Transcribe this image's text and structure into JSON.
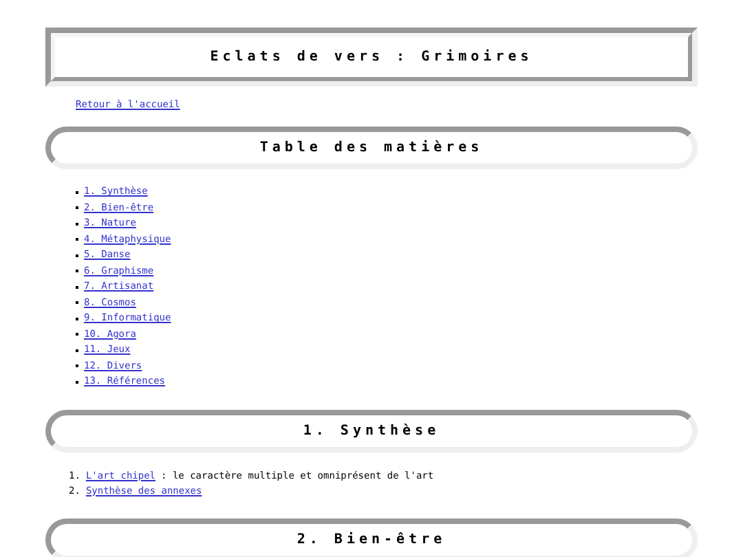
{
  "site_title": "Eclats de vers : Grimoires",
  "home_link": "Retour à l'accueil",
  "toc": {
    "heading": "Table des matières",
    "items": [
      {
        "label": "1. Synthèse"
      },
      {
        "label": "2. Bien-être"
      },
      {
        "label": "3. Nature"
      },
      {
        "label": "4. Métaphysique"
      },
      {
        "label": "5. Danse"
      },
      {
        "label": "6. Graphisme"
      },
      {
        "label": "7. Artisanat"
      },
      {
        "label": "8. Cosmos"
      },
      {
        "label": "9. Informatique"
      },
      {
        "label": "10. Agora"
      },
      {
        "label": "11. Jeux"
      },
      {
        "label": "12. Divers"
      },
      {
        "label": "13. Références"
      }
    ]
  },
  "sections": [
    {
      "heading": "1. Synthèse",
      "items": [
        {
          "number": "1.",
          "link": "L'art chipel",
          "text": ": le caractère multiple et omniprésent de l'art"
        },
        {
          "number": "2.",
          "link": "Synthèse des annexes"
        }
      ]
    },
    {
      "heading": "2. Bien-être"
    }
  ]
}
